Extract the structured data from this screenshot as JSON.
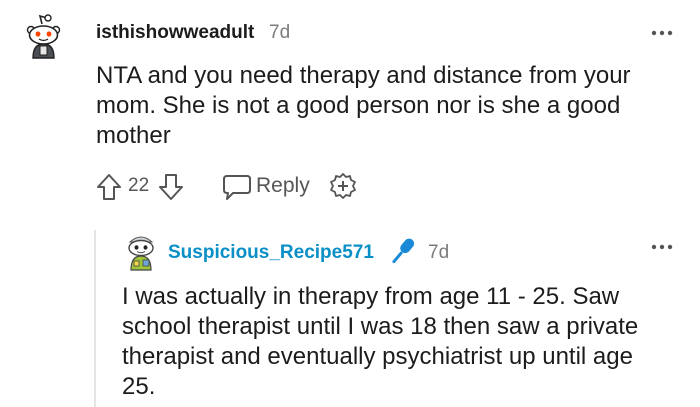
{
  "comment": {
    "username": "isthishowweadult",
    "time": "7d",
    "body": "NTA and you need therapy and distance from your mom. She is not a good person nor is she a good mother",
    "score": "22",
    "reply_label": "Reply",
    "icons": {
      "avatar": "snoo-avatar-icon",
      "more": "more-options-icon",
      "upvote": "upvote-arrow-icon",
      "downvote": "downvote-arrow-icon",
      "reply": "speech-bubble-icon",
      "award": "award-plus-icon"
    }
  },
  "reply": {
    "username": "Suspicious_Recipe571",
    "time": "7d",
    "body": "I was actually in therapy from age 11 - 25. Saw school therapist until I was 18 then saw a private therapist and eventually psychiatrist up until age 25.",
    "icons": {
      "avatar": "snoo-avatar-icon",
      "mic": "microphone-icon",
      "more": "more-options-icon"
    }
  },
  "colors": {
    "text": "#1c1c1c",
    "muted": "#7c7c7c",
    "reply_username": "#0a8fc7",
    "mic": "#1a8ad8"
  }
}
